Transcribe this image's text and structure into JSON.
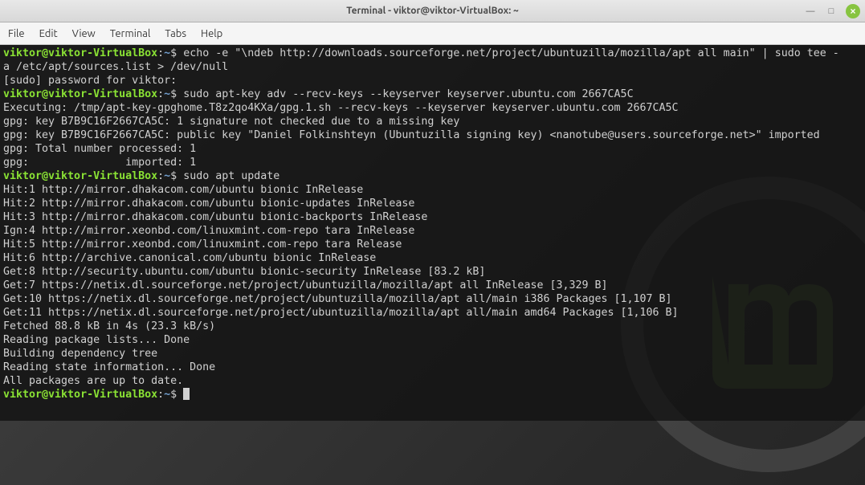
{
  "window": {
    "title": "Terminal - viktor@viktor-VirtualBox: ~"
  },
  "menu": {
    "file": "File",
    "edit": "Edit",
    "view": "View",
    "terminal": "Terminal",
    "tabs": "Tabs",
    "help": "Help"
  },
  "prompt": {
    "userhost": "viktor@viktor-VirtualBox",
    "path": "~",
    "sep": ":",
    "symbol": "$"
  },
  "lines": {
    "cmd1a": " echo -e \"\\ndeb http://downloads.sourceforge.net/project/ubuntuzilla/mozilla/apt all main\" | sudo tee -",
    "cmd1b": "a /etc/apt/sources.list > /dev/null",
    "out1": "[sudo] password for viktor:",
    "cmd2": " sudo apt-key adv --recv-keys --keyserver keyserver.ubuntu.com 2667CA5C",
    "out2a": "Executing: /tmp/apt-key-gpghome.T8z2qo4KXa/gpg.1.sh --recv-keys --keyserver keyserver.ubuntu.com 2667CA5C",
    "out2b": "gpg: key B7B9C16F2667CA5C: 1 signature not checked due to a missing key",
    "out2c": "gpg: key B7B9C16F2667CA5C: public key \"Daniel Folkinshteyn (Ubuntuzilla signing key) <nanotube@users.sourceforge.net>\" imported",
    "out2d": "gpg: Total number processed: 1",
    "out2e": "gpg:               imported: 1",
    "cmd3": " sudo apt update",
    "out3a": "Hit:1 http://mirror.dhakacom.com/ubuntu bionic InRelease",
    "out3b": "Hit:2 http://mirror.dhakacom.com/ubuntu bionic-updates InRelease",
    "out3c": "Hit:3 http://mirror.dhakacom.com/ubuntu bionic-backports InRelease",
    "out3d": "Ign:4 http://mirror.xeonbd.com/linuxmint.com-repo tara InRelease",
    "out3e": "Hit:5 http://mirror.xeonbd.com/linuxmint.com-repo tara Release",
    "out3f": "Hit:6 http://archive.canonical.com/ubuntu bionic InRelease",
    "out3g": "Get:8 http://security.ubuntu.com/ubuntu bionic-security InRelease [83.2 kB]",
    "out3h": "Get:7 https://netix.dl.sourceforge.net/project/ubuntuzilla/mozilla/apt all InRelease [3,329 B]",
    "out3i": "Get:10 https://netix.dl.sourceforge.net/project/ubuntuzilla/mozilla/apt all/main i386 Packages [1,107 B]",
    "out3j": "Get:11 https://netix.dl.sourceforge.net/project/ubuntuzilla/mozilla/apt all/main amd64 Packages [1,106 B]",
    "out3k": "Fetched 88.8 kB in 4s (23.3 kB/s)",
    "out3l": "Reading package lists... Done",
    "out3m": "Building dependency tree",
    "out3n": "Reading state information... Done",
    "out3o": "All packages are up to date."
  }
}
